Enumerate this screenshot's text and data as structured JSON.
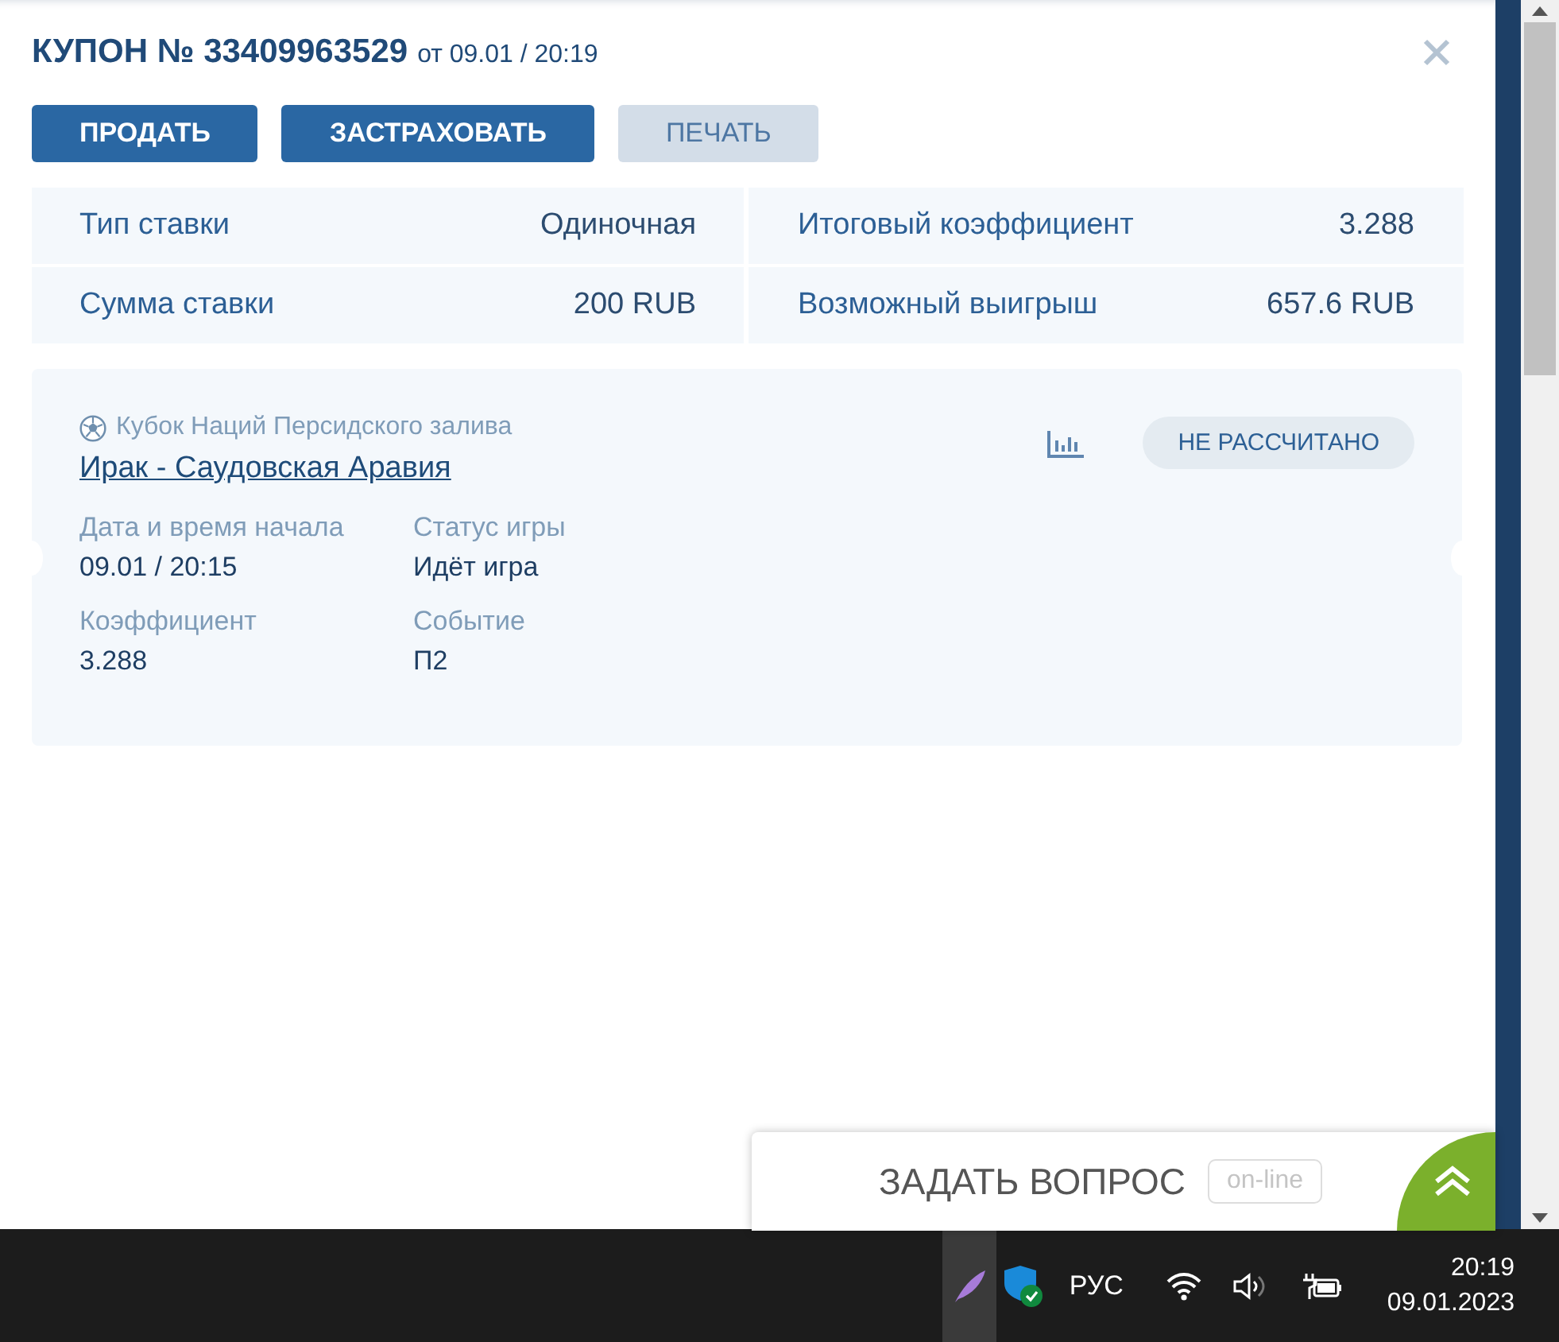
{
  "coupon": {
    "title": "КУПОН № 33409963529",
    "date": "от 09.01 / 20:19"
  },
  "buttons": [
    {
      "label": "ПРОДАТЬ",
      "disabled": false
    },
    {
      "label": "ЗАСТРАХОВАТЬ",
      "disabled": false
    },
    {
      "label": "ПЕЧАТЬ",
      "disabled": true
    }
  ],
  "summary": [
    {
      "label": "Тип ставки",
      "value": "Одиночная"
    },
    {
      "label": "Итоговый коэффициент",
      "value": "3.288"
    },
    {
      "label": "Сумма ставки",
      "value": "200 RUB"
    },
    {
      "label": "Возможный выигрыш",
      "value": "657.6 RUB"
    }
  ],
  "event": {
    "tournament": "Кубок Наций Персидского залива",
    "match": "Ирак - Саудовская Аравия",
    "status_badge": "НЕ РАССЧИТАНО",
    "fields": [
      {
        "label": "Дата и время начала",
        "value": "09.01 / 20:15"
      },
      {
        "label": "Статус игры",
        "value": "Идёт игра"
      },
      {
        "label": "Коэффициент",
        "value": "3.288"
      },
      {
        "label": "Событие",
        "value": "П2"
      }
    ]
  },
  "chat": {
    "label": "ЗАДАТЬ ВОПРОС",
    "badge": "on-line"
  },
  "taskbar": {
    "language": "РУС",
    "time": "20:19",
    "date": "09.01.2023"
  }
}
